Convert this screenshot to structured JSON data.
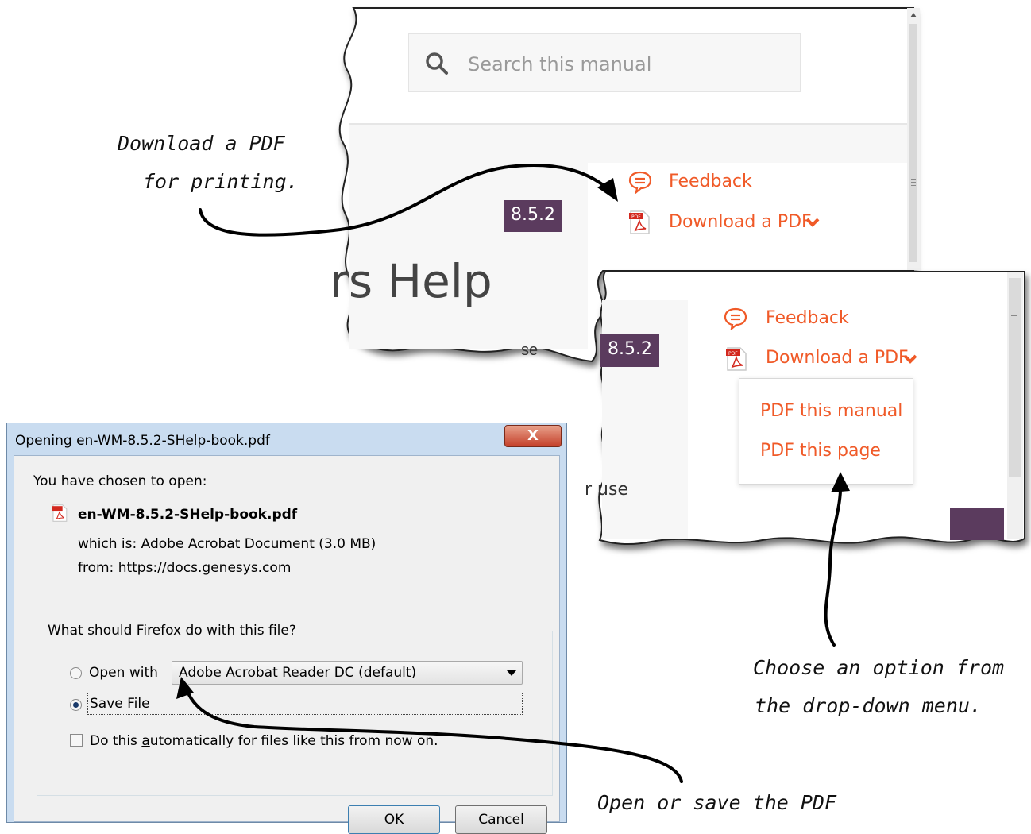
{
  "top_panel": {
    "search_placeholder": "Search this manual",
    "version": "8.5.2",
    "feedback": "Feedback",
    "download_pdf": "Download a PDF",
    "title_fragment": "rs Help",
    "cut_text": "se"
  },
  "menu_panel": {
    "version": "8.5.2",
    "feedback": "Feedback",
    "download_pdf": "Download a PDF",
    "options": [
      "PDF this manual",
      "PDF this page"
    ],
    "cut_text": "r use"
  },
  "dialog": {
    "title": "Opening en-WM-8.5.2-SHelp-book.pdf",
    "close": "X",
    "intro": "You have chosen to open:",
    "filename": "en-WM-8.5.2-SHelp-book.pdf",
    "which_is": "which is:  Adobe Acrobat Document (3.0 MB)",
    "from": "from:  https://docs.genesys.com",
    "question": "What should Firefox do with this file?",
    "open_with": {
      "prefix": "",
      "accel": "O",
      "rest": "pen with"
    },
    "app": "Adobe Acrobat Reader DC  (default)",
    "save_file": {
      "accel": "S",
      "rest": "ave File"
    },
    "auto": {
      "before": "Do this ",
      "accel": "a",
      "after": "utomatically for files like this from now on."
    },
    "ok": "OK",
    "cancel": "Cancel"
  },
  "annotations": {
    "download_line1": "Download a PDF",
    "download_line2": "for printing.",
    "choose_line1": "Choose an option from",
    "choose_line2": "the drop-down menu.",
    "open_save": "Open or save the PDF"
  },
  "colors": {
    "accent": "#f05a28",
    "badge": "#5b3b5e"
  }
}
